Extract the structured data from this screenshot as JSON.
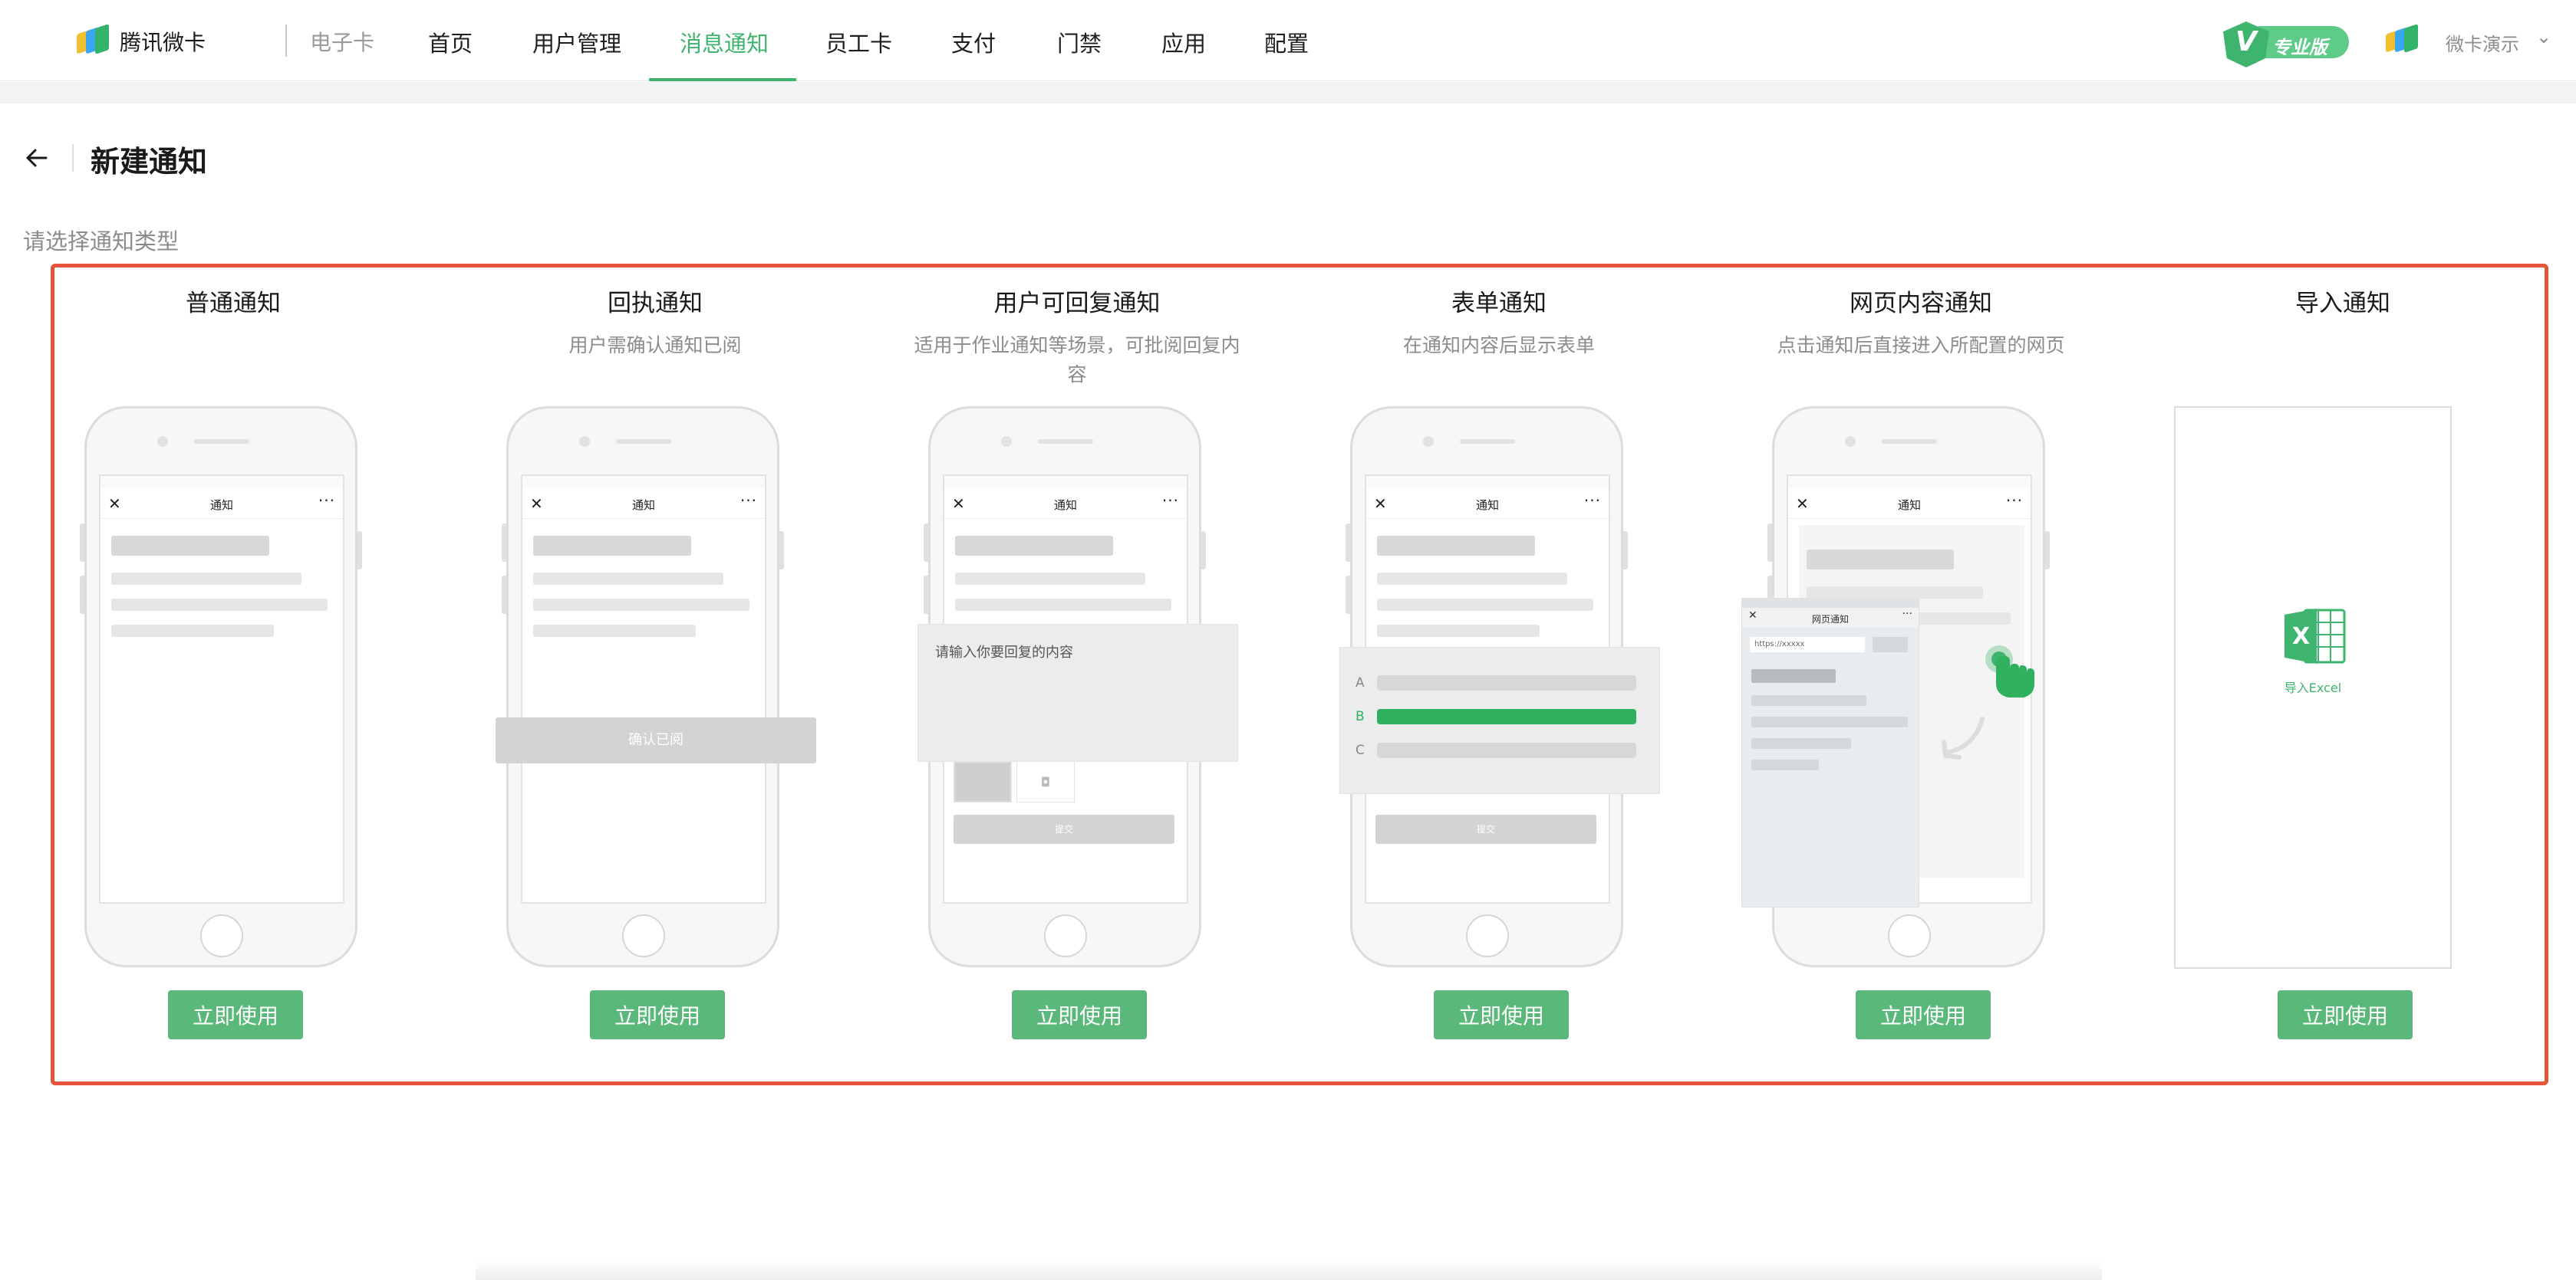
{
  "app": {
    "name": "腾讯微卡",
    "sub": "电子卡"
  },
  "nav": {
    "items": [
      {
        "label": "首页"
      },
      {
        "label": "用户管理"
      },
      {
        "label": "消息通知"
      },
      {
        "label": "员工卡"
      },
      {
        "label": "支付"
      },
      {
        "label": "门禁"
      },
      {
        "label": "应用"
      },
      {
        "label": "配置"
      }
    ],
    "active_index": 2
  },
  "badge": {
    "label": "专业版"
  },
  "user": {
    "name": "微卡演示"
  },
  "page": {
    "title": "新建通知",
    "section_label": "请选择通知类型"
  },
  "cards": [
    {
      "title": "普通通知",
      "desc": "",
      "button": "立即使用"
    },
    {
      "title": "回执通知",
      "desc": "用户需确认通知已阅",
      "button": "立即使用"
    },
    {
      "title": "用户可回复通知",
      "desc": "适用于作业通知等场景，可批阅回复内容",
      "button": "立即使用"
    },
    {
      "title": "表单通知",
      "desc": "在通知内容后显示表单",
      "button": "立即使用"
    },
    {
      "title": "网页内容通知",
      "desc": "点击通知后直接进入所配置的网页",
      "button": "立即使用"
    },
    {
      "title": "导入通知",
      "desc": "",
      "button": "立即使用"
    }
  ],
  "phone": {
    "screen_title": "通知",
    "confirm_label": "确认已阅",
    "reply_placeholder": "请输入你要回复的内容",
    "submit_label": "提交",
    "form_options": [
      "A",
      "B",
      "C"
    ],
    "web_screen_title": "网页通知",
    "web_url": "https://xxxxx",
    "excel_label": "导入Excel"
  },
  "colors": {
    "accent": "#3eb46e",
    "button": "#5ab87a",
    "highlight_border": "#e5533a"
  }
}
